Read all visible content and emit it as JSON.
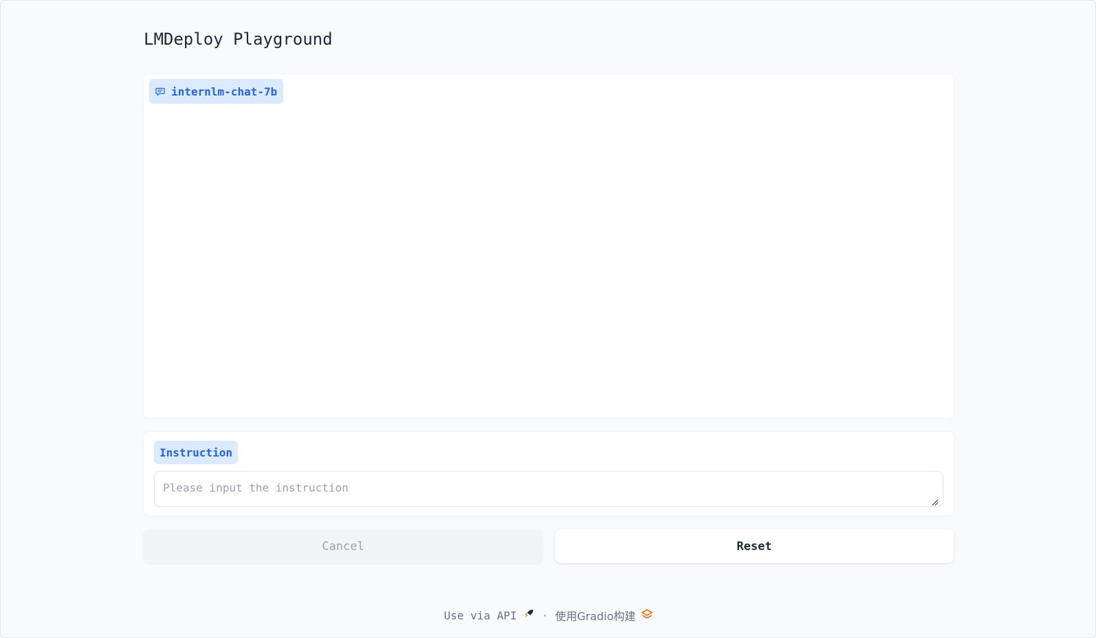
{
  "page": {
    "title": "LMDeploy Playground"
  },
  "chatbot": {
    "label": "internlm-chat-7b",
    "label_icon": "chat-bubble-icon"
  },
  "instruction": {
    "label": "Instruction",
    "placeholder": "Please input the instruction",
    "value": ""
  },
  "buttons": {
    "cancel_label": "Cancel",
    "reset_label": "Reset"
  },
  "footer": {
    "api_label": "Use via API",
    "api_icon": "rocket-icon",
    "separator": "·",
    "built_with_label": "使用Gradio构建",
    "gradio_icon": "gradio-logo-icon"
  },
  "colors": {
    "accent": "#2563eb",
    "label_bg": "#dbeafe",
    "footer_icon": "#f97316"
  }
}
